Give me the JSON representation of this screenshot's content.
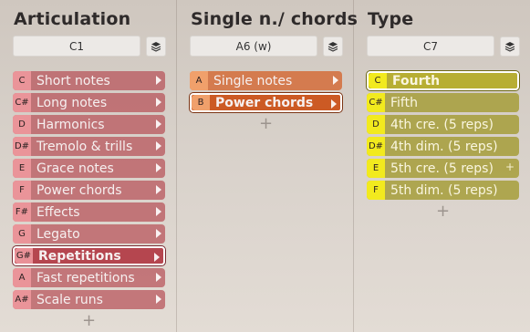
{
  "columns": [
    {
      "title": "Articulation",
      "key": "C1",
      "theme": "red",
      "selected_index": 8,
      "items": [
        {
          "note": "C",
          "label": "Short notes"
        },
        {
          "note": "C#",
          "label": "Long notes"
        },
        {
          "note": "D",
          "label": "Harmonics"
        },
        {
          "note": "D#",
          "label": "Tremolo & trills"
        },
        {
          "note": "E",
          "label": "Grace notes"
        },
        {
          "note": "F",
          "label": "Power chords"
        },
        {
          "note": "F#",
          "label": "Effects"
        },
        {
          "note": "G",
          "label": "Legato"
        },
        {
          "note": "G#",
          "label": "Repetitions"
        },
        {
          "note": "A",
          "label": "Fast repetitions"
        },
        {
          "note": "A#",
          "label": "Scale runs"
        }
      ],
      "add_label": "+"
    },
    {
      "title": "Single n./ chords",
      "key": "A6 (w)",
      "theme": "orange",
      "selected_index": 1,
      "items": [
        {
          "note": "A",
          "label": "Single notes"
        },
        {
          "note": "B",
          "label": "Power chords"
        }
      ],
      "add_label": "+"
    },
    {
      "title": "Type",
      "key": "C7",
      "theme": "yellow",
      "selected_index": 0,
      "items": [
        {
          "note": "C",
          "label": "Fourth"
        },
        {
          "note": "C#",
          "label": "Fifth"
        },
        {
          "note": "D",
          "label": "4th cre. (5 reps)"
        },
        {
          "note": "D#",
          "label": "4th dim. (5 reps)"
        },
        {
          "note": "E",
          "label": "5th cre. (5 reps)"
        },
        {
          "note": "F",
          "label": "5th dim. (5 reps)"
        }
      ],
      "add_label": "+"
    }
  ],
  "icons": {
    "stack": "stack-icon",
    "arrow": "chevron-right-icon",
    "plus": "plus-icon"
  },
  "colors": {
    "red_item": "#b7505a",
    "red_note": "#ec969b",
    "orange_item": "#d46c3a",
    "orange_note": "#f0a06b",
    "yellow_item": "#a69e3a",
    "yellow_note": "#f2ea1e"
  }
}
